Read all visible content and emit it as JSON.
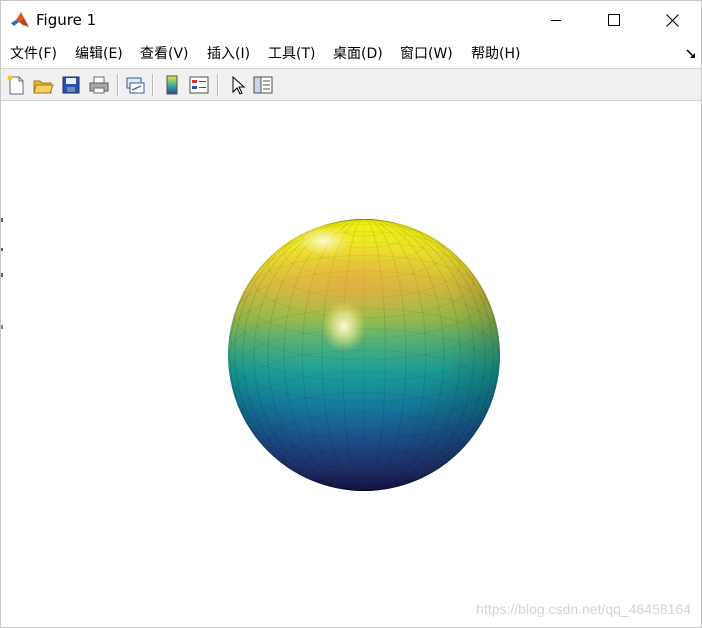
{
  "window": {
    "title": "Figure 1",
    "controls": {
      "minimize": "minimize",
      "maximize": "maximize",
      "close": "close"
    }
  },
  "menu": {
    "items": [
      {
        "label": "文件(F)"
      },
      {
        "label": "编辑(E)"
      },
      {
        "label": "查看(V)"
      },
      {
        "label": "插入(I)"
      },
      {
        "label": "工具(T)"
      },
      {
        "label": "桌面(D)"
      },
      {
        "label": "窗口(W)"
      },
      {
        "label": "帮助(H)"
      }
    ]
  },
  "toolbar": {
    "buttons": [
      {
        "icon": "new-figure-icon"
      },
      {
        "icon": "open-file-icon"
      },
      {
        "icon": "save-icon"
      },
      {
        "icon": "print-icon"
      },
      {
        "icon": "link-plot-icon"
      },
      {
        "icon": "colorbar-icon"
      },
      {
        "icon": "legend-icon"
      },
      {
        "icon": "pointer-icon"
      },
      {
        "icon": "property-inspector-icon"
      }
    ]
  },
  "figure": {
    "plot_type": "3D surface sphere",
    "colormap": "parula",
    "colors": {
      "top": "#f9fb0e",
      "middle": "#1ba09a",
      "bottom": "#1a1a5e",
      "highlight": "#fffbd0"
    }
  },
  "watermark": {
    "text": "https://blog.csdn.net/qq_46458164"
  }
}
